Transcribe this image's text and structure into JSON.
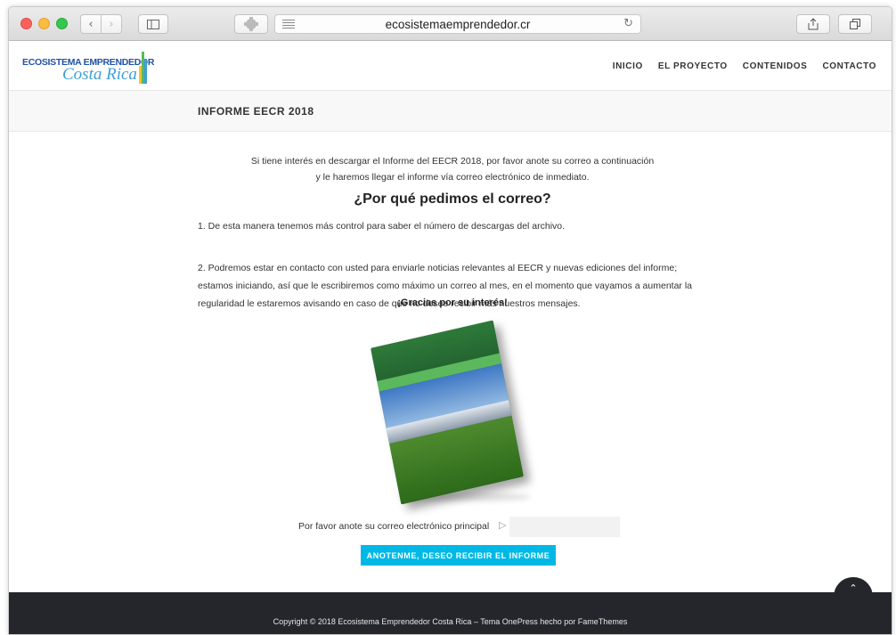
{
  "browser": {
    "url": "ecosistemaemprendedor.cr",
    "back_icon": "chevron-left-icon",
    "forward_icon": "chevron-right-icon",
    "reload_icon": "reload-icon",
    "share_icon": "share-icon",
    "tabs_icon": "tabs-icon",
    "new_tab_label": "+"
  },
  "site": {
    "logo_top": "ECOSISTEMA EMPRENDEDOR",
    "logo_bottom": "Costa Rica",
    "logo_colors": [
      "#f4c430",
      "#e8323c",
      "#3d9fd8",
      "#5cb85c"
    ],
    "nav": [
      "INICIO",
      "EL PROYECTO",
      "CONTENIDOS",
      "CONTACTO"
    ]
  },
  "page": {
    "title": "INFORME EECR 2018",
    "intro_line1": "Si tiene interés en descargar el Informe del EECR 2018, por favor anote su correo a continuación",
    "intro_line2": "y le haremos llegar el informe vía correo electrónico de inmediato.",
    "question": "¿Por qué pedimos el correo?",
    "para1": "1. De esta manera tenemos más control para saber el número de descargas del archivo.",
    "para2_line1": "2. Podremos estar en contacto con usted para enviarle noticias relevantes al EECR y nuevas ediciones del informe;",
    "para2_line2": "estamos iniciando, así que le escribiremos como máximo un correo al mes, en el momento que vayamos a aumentar la",
    "para2_line3": "regularidad le estaremos avisando en caso de que no desee recibir más nuestros mensajes.",
    "thanks": "¡Gracias por su interés!"
  },
  "form": {
    "email_label": "Por favor anote su correo electrónico principal",
    "arrow_glyph": "▷",
    "email_value": "",
    "submit_label": "ANOTENME, DESEO RECIBIR EL INFORME",
    "accent_color": "#00b8e6"
  },
  "footer": {
    "copyright": "Copyright © 2018 Ecosistema Emprendedor Costa Rica – Tema OnePress hecho por FameThemes",
    "back_to_top_glyph": "︽"
  }
}
